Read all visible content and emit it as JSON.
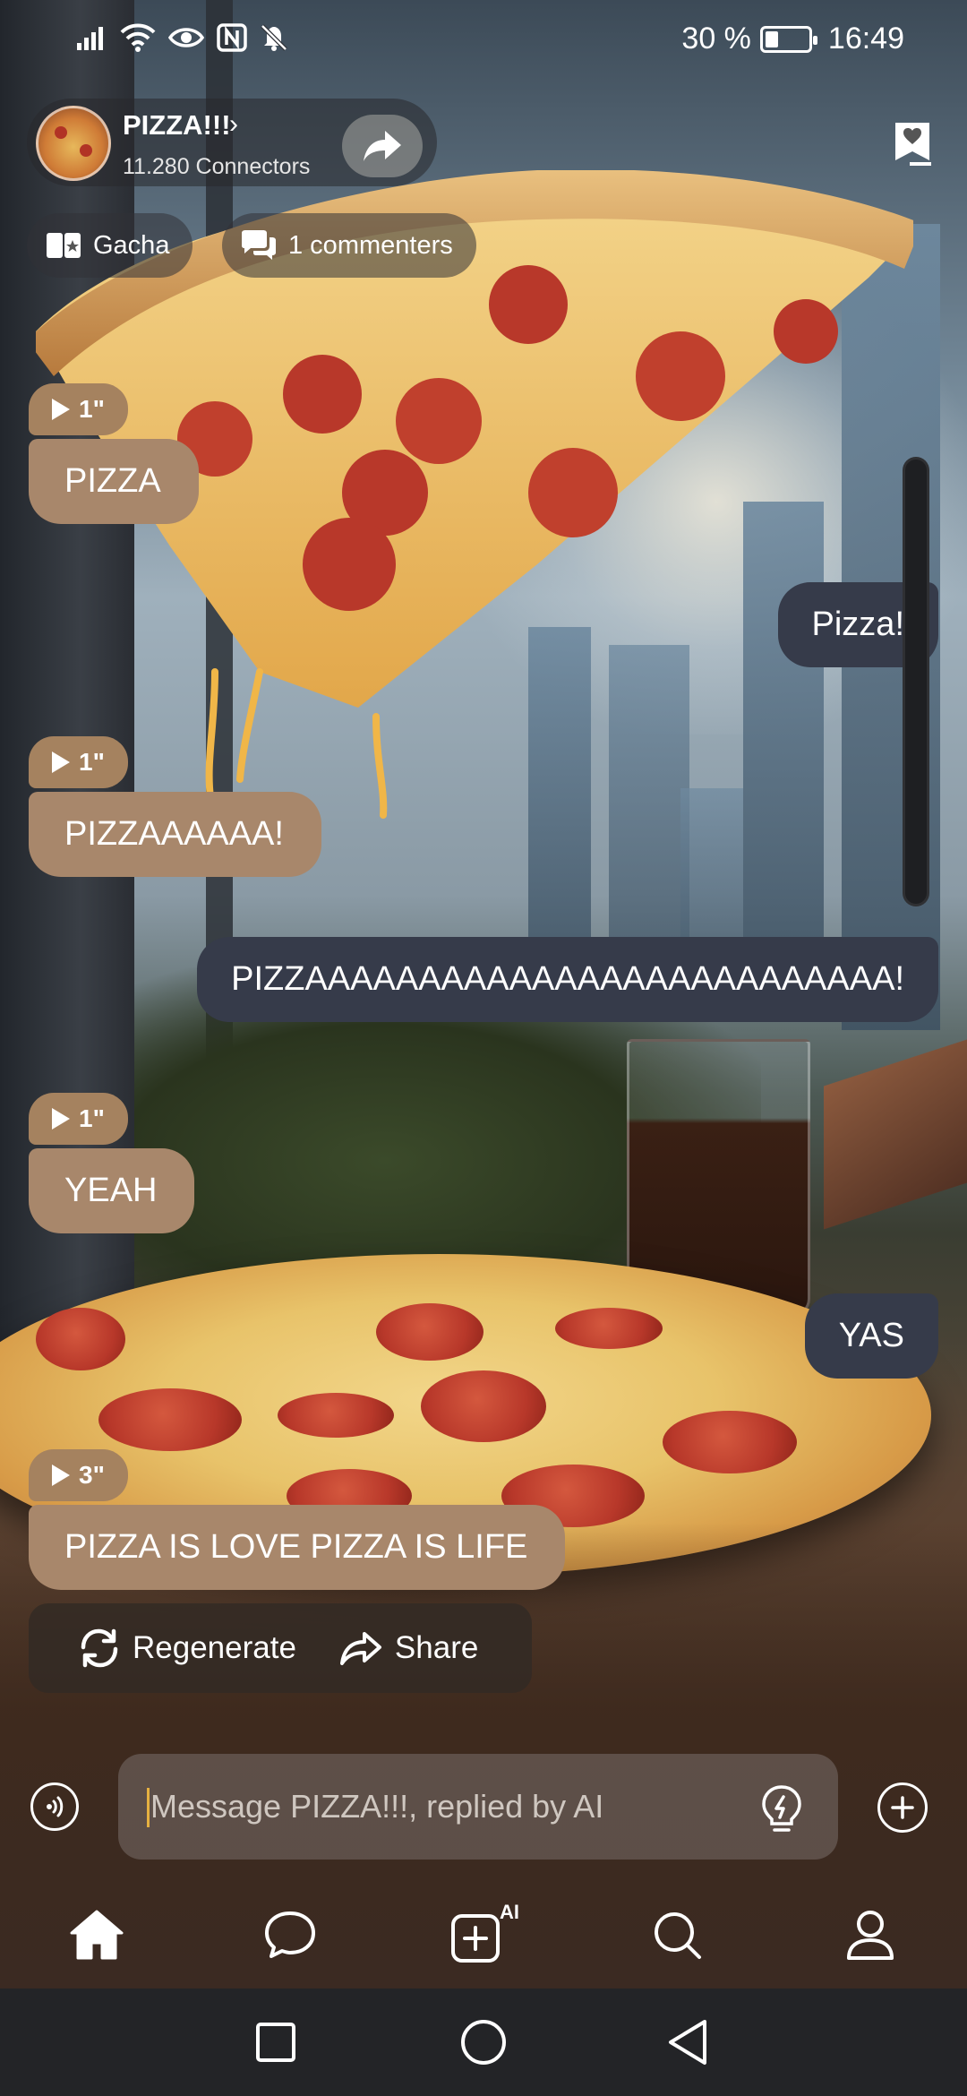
{
  "status_bar": {
    "battery_percent": "30 %",
    "battery_level": 0.3,
    "time": "16:49",
    "icons": [
      "signal-icon",
      "wifi-icon",
      "eye-icon",
      "nfc-icon",
      "bell-muted-icon"
    ]
  },
  "header": {
    "bot_name": "PIZZA!!!",
    "connectors": "11.280 Connectors",
    "chips": {
      "gacha": "Gacha",
      "commenters": "1 commenters"
    }
  },
  "messages": [
    {
      "role": "bot",
      "duration": "1\"",
      "text": "PIZZA"
    },
    {
      "role": "user",
      "text": "Pizza!"
    },
    {
      "role": "bot",
      "duration": "1\"",
      "text": "PIZZAAAAAA!"
    },
    {
      "role": "user",
      "text": "PIZZAAAAAAAAAAAAAAAAAAAAAAAAAA!"
    },
    {
      "role": "bot",
      "duration": "1\"",
      "text": "YEAH"
    },
    {
      "role": "user",
      "text": "YAS"
    },
    {
      "role": "bot",
      "duration": "3\"",
      "text": "PIZZA IS LOVE PIZZA IS LIFE"
    }
  ],
  "actions": {
    "regenerate": "Regenerate",
    "share": "Share"
  },
  "composer": {
    "placeholder": "Message PIZZA!!!, replied by AI"
  },
  "nav": {
    "items": [
      "home-icon",
      "chat-icon",
      "ai-create-icon",
      "search-icon",
      "profile-icon"
    ],
    "ai_badge": "AI"
  },
  "colors": {
    "bot_bubble": "#a8876b",
    "user_bubble": "#363b4a",
    "accent": "#e5b040"
  }
}
